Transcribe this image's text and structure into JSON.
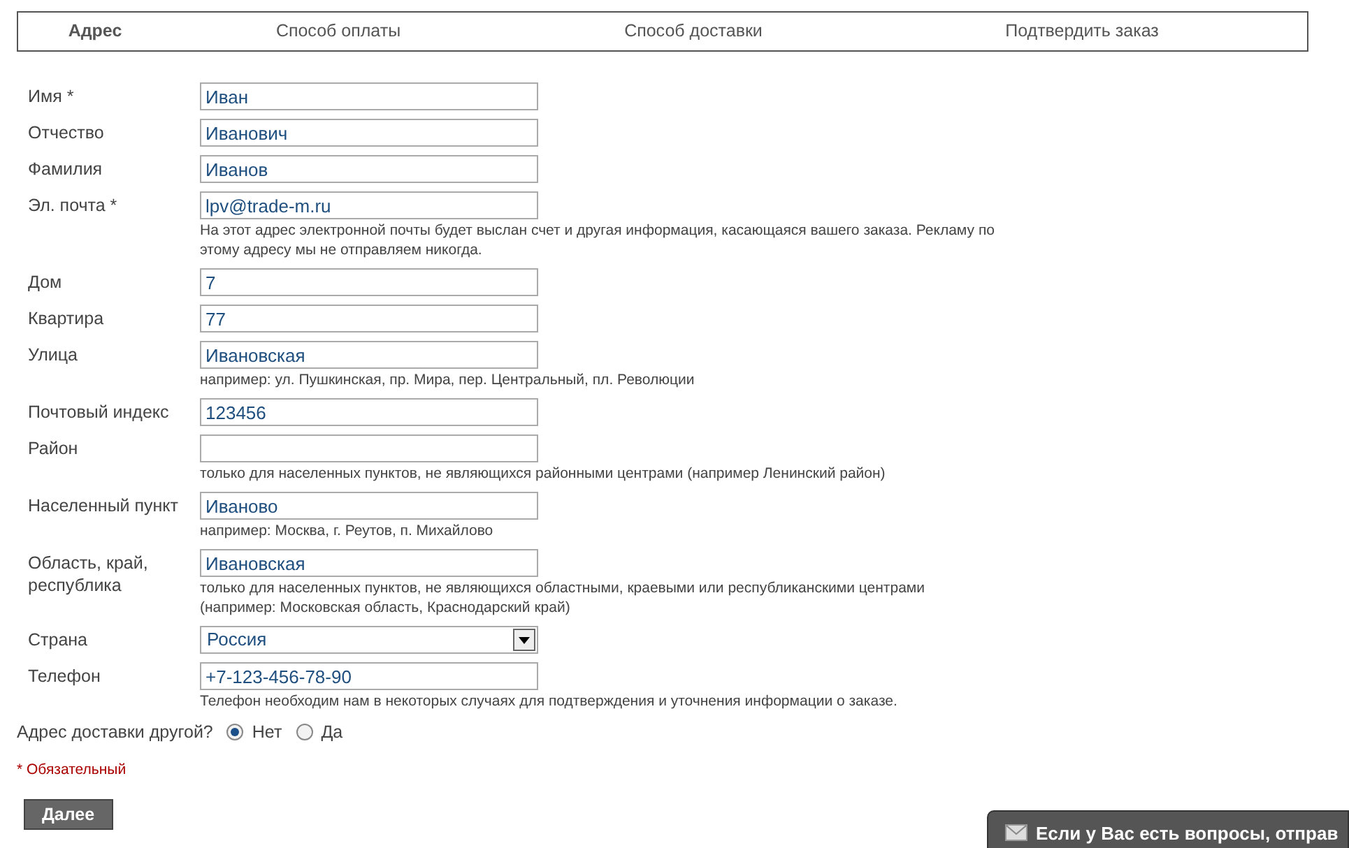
{
  "steps": [
    {
      "label": "Адрес",
      "selected": true
    },
    {
      "label": "Способ оплаты",
      "selected": false
    },
    {
      "label": "Способ доставки",
      "selected": false
    },
    {
      "label": "Подтвердить заказ",
      "selected": false
    }
  ],
  "fields": [
    {
      "label": "Имя *",
      "kind": "text",
      "value": "Иван"
    },
    {
      "label": "Отчество",
      "kind": "text",
      "value": "Иванович"
    },
    {
      "label": "Фамилия",
      "kind": "text",
      "value": "Иванов"
    },
    {
      "label": "Эл. почта *",
      "kind": "text",
      "value": "lpv@trade-m.ru",
      "hint": [
        "На этот адрес электронной почты будет выслан счет и другая информация, касающаяся вашего заказа. Рекламу по",
        "этому адресу мы не отправляем никогда."
      ]
    },
    {
      "label": "Дом",
      "kind": "text",
      "value": "7"
    },
    {
      "label": "Квартира",
      "kind": "text",
      "value": "77"
    },
    {
      "label": "Улица",
      "kind": "text",
      "value": "Ивановская",
      "hint": [
        "например: ул. Пушкинская, пр. Мира, пер. Центральный, пл. Революции"
      ]
    },
    {
      "label": "Почтовый индекс",
      "kind": "text",
      "value": "123456"
    },
    {
      "label": "Район",
      "kind": "text",
      "hint": [
        "только для населенных пунктов, не являющихся районными центрами (например Ленинский район)"
      ]
    },
    {
      "label": "Населенный пункт",
      "kind": "text",
      "value": "Иваново",
      "hint": [
        "например: Москва, г. Реутов, п. Михайлово"
      ]
    },
    {
      "label": "Область, край, республика",
      "kind": "text",
      "value": "Ивановская",
      "hint": [
        "только для населенных пунктов, не являющихся областными, краевыми или республиканскими центрами",
        "(например: Московская область, Краснодарский край)"
      ]
    },
    {
      "label": "Страна",
      "kind": "select",
      "value": "Россия"
    },
    {
      "label": "Телефон",
      "kind": "text",
      "value": "+7-123-456-78-90",
      "hint": [
        "Телефон необходим нам в некоторых случаях для подтверждения и уточнения информации о заказе."
      ]
    }
  ],
  "other_address": {
    "label": "Адрес доставки другой?",
    "options": [
      {
        "label": "Нет",
        "selected": true
      },
      {
        "label": "Да",
        "selected": false
      }
    ]
  },
  "required_note": "* Обязательный",
  "next_button": "Далее",
  "chat_widget": "Если у Вас есть вопросы, отправ"
}
